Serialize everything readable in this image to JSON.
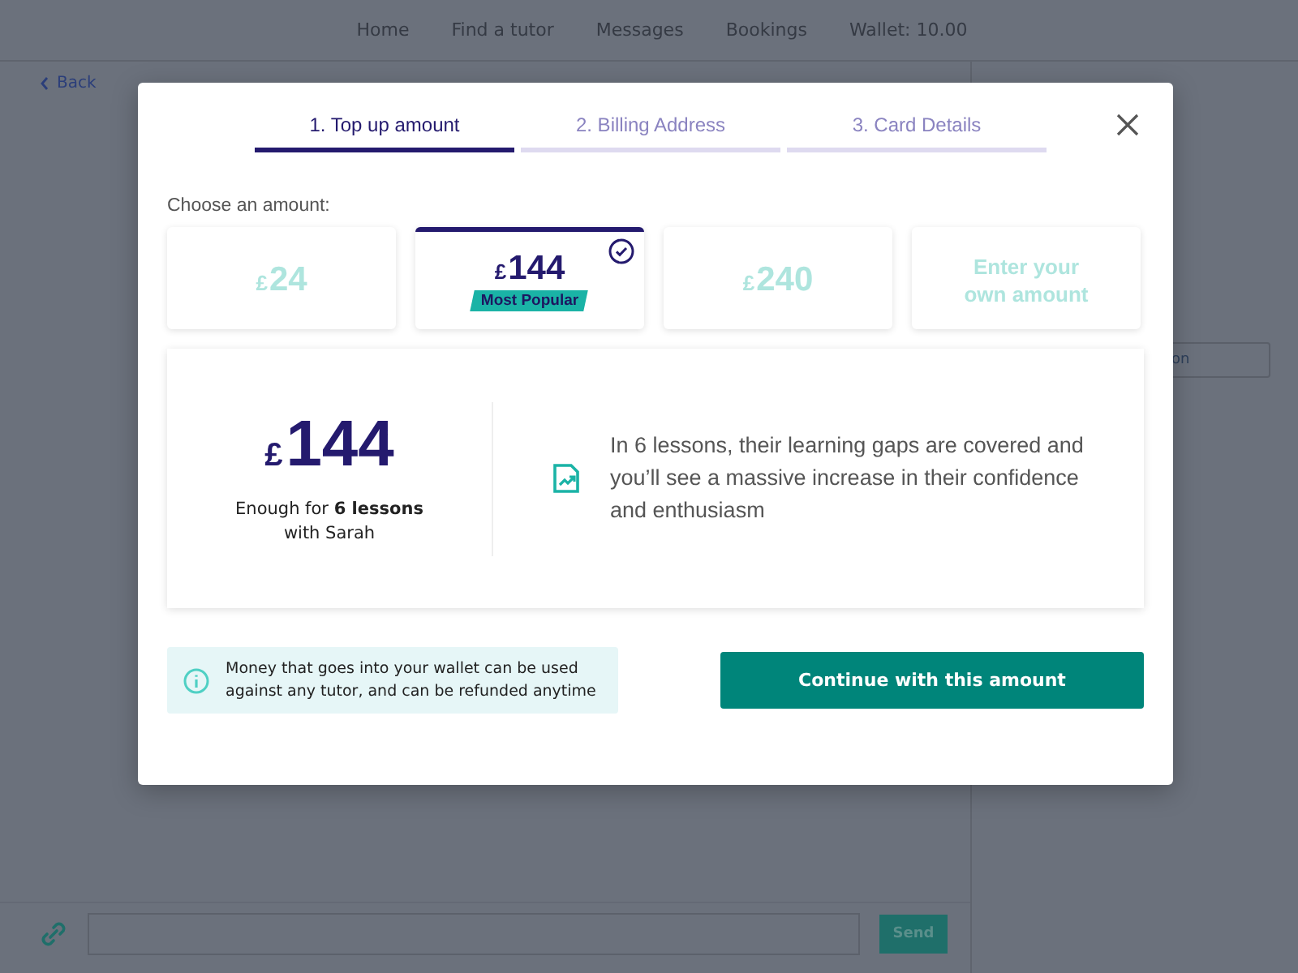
{
  "nav": {
    "items": [
      {
        "label": "Home"
      },
      {
        "label": "Find a tutor"
      },
      {
        "label": "Messages"
      },
      {
        "label": "Bookings"
      },
      {
        "label": "Wallet: 10.00"
      }
    ]
  },
  "back_link": "Back",
  "side_button": "on",
  "composer": {
    "send": "Send"
  },
  "modal": {
    "steps": [
      {
        "label": "1. Top up amount",
        "selected": true
      },
      {
        "label": "2. Billing Address",
        "selected": false
      },
      {
        "label": "3. Card Details",
        "selected": false
      }
    ],
    "prompt": "Choose an amount:",
    "amounts": [
      {
        "kind": "preset",
        "currency": "£",
        "value": "24",
        "selected": false
      },
      {
        "kind": "preset",
        "currency": "£",
        "value": "144",
        "selected": true,
        "badge": "Most Popular"
      },
      {
        "kind": "preset",
        "currency": "£",
        "value": "240",
        "selected": false
      },
      {
        "kind": "custom",
        "label": "Enter your own amount",
        "selected": false
      }
    ],
    "summary": {
      "currency": "£",
      "value": "144",
      "caption": "Enough for **6 lessons** with Sarah",
      "benefit": "In 6 lessons, their learning gaps are covered and you’ll see a massive increase in their confidence and enthusiasm"
    },
    "info": "Money that goes into your wallet can be used against any tutor, and can be refunded anytime",
    "continue": "Continue with this amount"
  }
}
